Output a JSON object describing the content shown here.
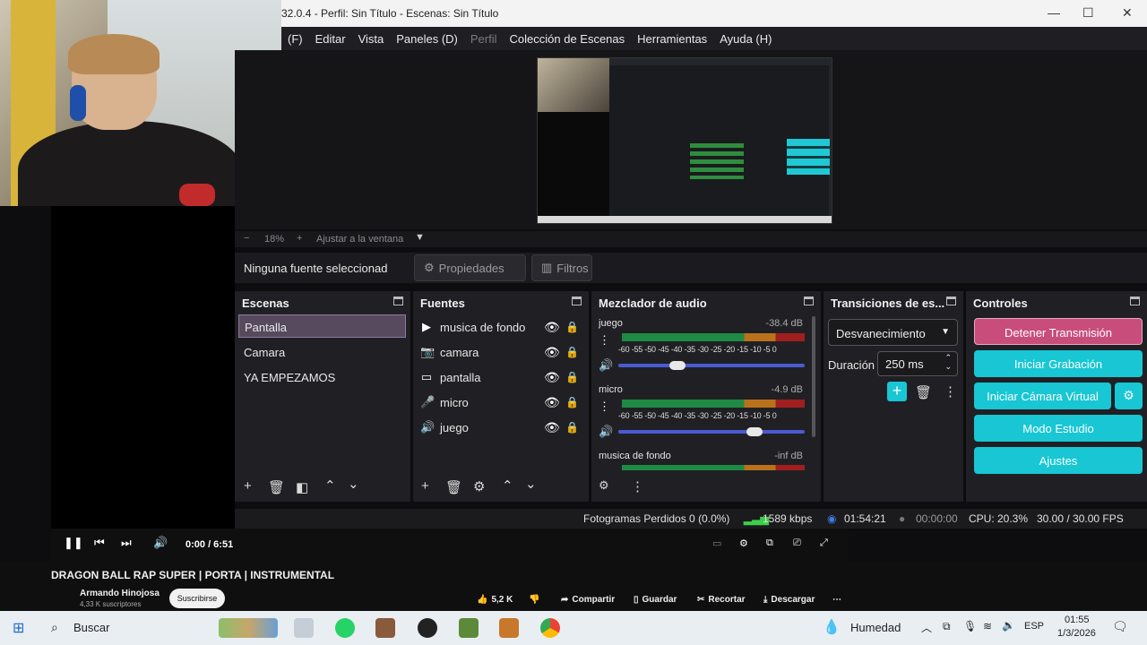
{
  "window": {
    "title": "32.0.4 - Perfil: Sin Título - Escenas: Sin Título",
    "minimize": "—",
    "maximize": "☐",
    "close": "✕"
  },
  "menu": {
    "items": [
      "(F)",
      "Editar",
      "Vista",
      "Paneles (D)",
      "Perfil",
      "Colección de Escenas",
      "Herramientas",
      "Ayuda (H)"
    ]
  },
  "zoom": {
    "minus": "−",
    "value": "18%",
    "plus": "+",
    "fit": "Ajustar a la ventana"
  },
  "source_toolbar": {
    "status": "Ninguna fuente seleccionad",
    "properties": "Propiedades",
    "filters": "Filtros"
  },
  "scenes": {
    "title": "Escenas",
    "items": [
      "Pantalla",
      "Camara",
      "YA EMPEZAMOS"
    ],
    "selected": "Pantalla"
  },
  "sources": {
    "title": "Fuentes",
    "items": [
      {
        "label": "musica de fondo",
        "icon": "play-icon"
      },
      {
        "label": "camara",
        "icon": "camera-icon"
      },
      {
        "label": "pantalla",
        "icon": "monitor-icon"
      },
      {
        "label": "micro",
        "icon": "microphone-icon"
      },
      {
        "label": "juego",
        "icon": "speaker-icon"
      }
    ]
  },
  "mixer": {
    "title": "Mezclador de audio",
    "ticks": "-60 -55 -50 -45 -40 -35 -30 -25 -20 -15 -10 -5 0",
    "channels": [
      {
        "name": "juego",
        "db": "-38.4 dB",
        "volume": 0.3
      },
      {
        "name": "micro",
        "db": "-4.9 dB",
        "volume": 0.75
      },
      {
        "name": "musica de fondo",
        "db": "-inf dB",
        "volume": 0.0
      }
    ]
  },
  "transitions": {
    "title": "Transiciones de es...",
    "selected": "Desvanecimiento",
    "duration_label": "Duración",
    "duration_value": "250 ms"
  },
  "controls": {
    "title": "Controles",
    "buttons": [
      "Detener Transmisión",
      "Iniciar Grabación",
      "Iniciar Cámara Virtual",
      "Modo Estudio",
      "Ajustes"
    ]
  },
  "status": {
    "dropped": "Fotogramas Perdidos 0 (0.0%)",
    "bitrate": "1589 kbps",
    "stream_time": "01:54:21",
    "rec_time": "00:00:00",
    "cpu": "CPU: 20.3%",
    "fps": "30.00 / 30.00 FPS"
  },
  "youtube": {
    "time": "0:00 / 6:51",
    "title": "DRAGON BALL RAP SUPER | PORTA | INSTRUMENTAL",
    "channel": "Armando Hinojosa",
    "subs": "4,33 K suscriptores",
    "subscribe": "Suscribirse",
    "likes": "5,2 K",
    "share": "Compartir",
    "save": "Guardar",
    "clip": "Recortar",
    "download": "Descargar"
  },
  "taskbar": {
    "search": "Buscar",
    "weather": "Humedad",
    "lang": "ESP",
    "time": "01:55",
    "date": "1/3/2026"
  },
  "colors": {
    "accent": "#18c6d4",
    "stop": "#c84d7a",
    "scene_sel": "#574a5e"
  }
}
